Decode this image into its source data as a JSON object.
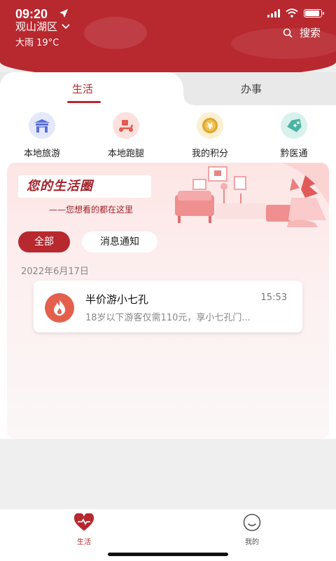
{
  "status_bar": {
    "time": "09:20"
  },
  "header": {
    "location": "观山湖区",
    "weather": "大雨 19°C",
    "search_label": "搜索"
  },
  "tabs": [
    {
      "label": "生活",
      "active": true
    },
    {
      "label": "办事",
      "active": false
    }
  ],
  "quick_links": [
    {
      "label": "本地旅游",
      "icon": "gate-icon",
      "color": "#5b6fd6"
    },
    {
      "label": "本地跑腿",
      "icon": "scooter-icon",
      "color": "#e45b4f"
    },
    {
      "label": "我的积分",
      "icon": "coin-icon",
      "color": "#e0a62c",
      "icon_text": "¥"
    },
    {
      "label": "黔医通",
      "icon": "medical-tag-icon",
      "color": "#4bb3a2"
    }
  ],
  "banner": {
    "title": "您的生活圈",
    "subtitle": "——您想看的都在这里"
  },
  "filters": [
    {
      "label": "全部",
      "active": true
    },
    {
      "label": "消息通知",
      "active": false
    }
  ],
  "feed": {
    "date": "2022年6月17日",
    "items": [
      {
        "title": "半价游小七孔",
        "time": "15:53",
        "description": "18岁以下游客仅需110元，享小七孔门...",
        "icon": "fire-icon"
      }
    ]
  },
  "bottom_nav": [
    {
      "label": "生活",
      "icon": "heart-icon",
      "active": true
    },
    {
      "label": "我的",
      "icon": "smiley-icon",
      "active": false
    }
  ],
  "colors": {
    "brand": "#b8282f",
    "background": "#efefef"
  }
}
